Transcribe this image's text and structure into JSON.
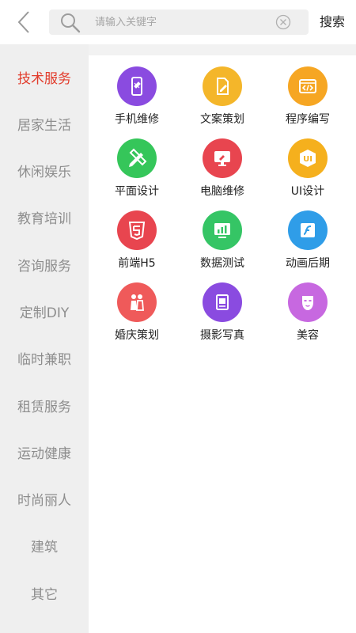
{
  "search": {
    "placeholder": "请输入关键字",
    "button_label": "搜索"
  },
  "sidebar": {
    "items": [
      {
        "label": "技术服务",
        "active": true
      },
      {
        "label": "居家生活"
      },
      {
        "label": "休闲娱乐"
      },
      {
        "label": "教育培训"
      },
      {
        "label": "咨询服务"
      },
      {
        "label": "定制DIY"
      },
      {
        "label": "临时兼职"
      },
      {
        "label": "租赁服务"
      },
      {
        "label": "运动健康"
      },
      {
        "label": "时尚丽人"
      },
      {
        "label": "建筑"
      },
      {
        "label": "其它"
      }
    ]
  },
  "services": [
    {
      "label": "手机维修",
      "icon": "phone-repair-icon",
      "color": "#8a4be0"
    },
    {
      "label": "文案策划",
      "icon": "document-pen-icon",
      "color": "#f4b62a"
    },
    {
      "label": "程序编写",
      "icon": "code-window-icon",
      "color": "#f6a623"
    },
    {
      "label": "平面设计",
      "icon": "pencil-ruler-icon",
      "color": "#35c65a"
    },
    {
      "label": "电脑维修",
      "icon": "monitor-repair-icon",
      "color": "#e8454f"
    },
    {
      "label": "UI设计",
      "icon": "ui-badge-icon",
      "color": "#f5b01d"
    },
    {
      "label": "前端H5",
      "icon": "html5-icon",
      "color": "#e8454f"
    },
    {
      "label": "数据测试",
      "icon": "chart-screen-icon",
      "color": "#35c565"
    },
    {
      "label": "动画后期",
      "icon": "flash-icon",
      "color": "#2f9de8"
    },
    {
      "label": "婚庆策划",
      "icon": "couple-icon",
      "color": "#ef5a5a"
    },
    {
      "label": "摄影写真",
      "icon": "photo-album-icon",
      "color": "#8a4be0"
    },
    {
      "label": "美容",
      "icon": "face-mask-icon",
      "color": "#c768e0"
    }
  ]
}
